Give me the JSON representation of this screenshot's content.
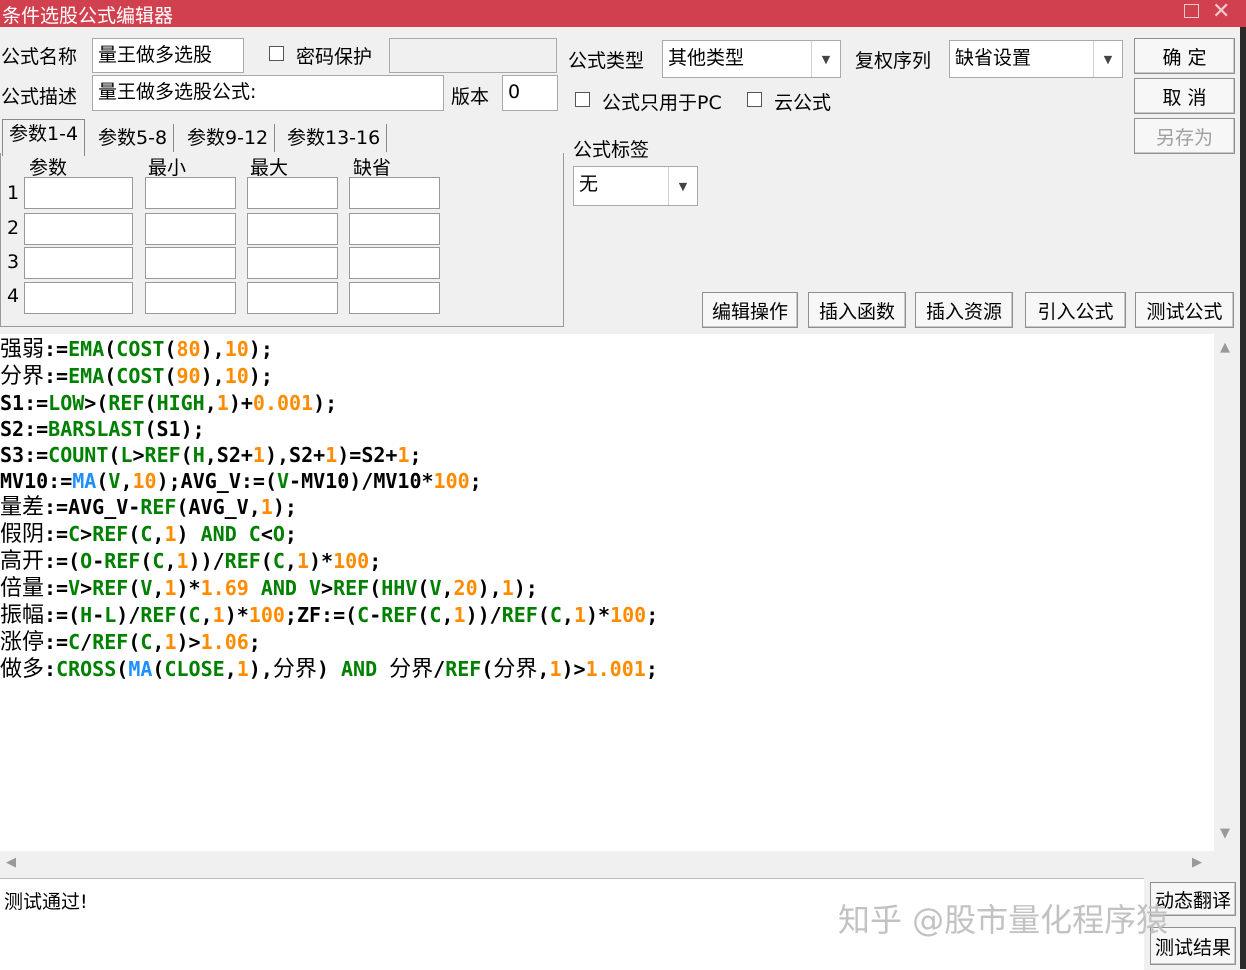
{
  "window": {
    "title": "条件选股公式编辑器"
  },
  "name_label": "公式名称",
  "name_value": "量王做多选股",
  "password_label": "密码保护",
  "desc_label": "公式描述",
  "desc_value": "量王做多选股公式:",
  "version_label": "版本",
  "version_value": "0",
  "type_label": "公式类型",
  "type_value": "其他类型",
  "fuquan_label": "复权序列",
  "fuquan_value": "缺省设置",
  "pc_only_label": "公式只用于PC",
  "cloud_label": "云公式",
  "tag_label": "公式标签",
  "tag_value": "无",
  "buttons": {
    "ok": "确  定",
    "cancel": "取  消",
    "save_as": "另存为",
    "edit_ops": "编辑操作",
    "insert_func": "插入函数",
    "insert_res": "插入资源",
    "import_formula": "引入公式",
    "test_formula": "测试公式",
    "dynamic_translate": "动态翻译",
    "test_result": "测试结果"
  },
  "tabs": [
    "参数1-4",
    "参数5-8",
    "参数9-12",
    "参数13-16"
  ],
  "param_headers": [
    "参数",
    "最小",
    "最大",
    "缺省"
  ],
  "param_rows": [
    "1",
    "2",
    "3",
    "4"
  ],
  "code_lines": [
    "强弱:=EMA(COST(80),10);",
    "分界:=EMA(COST(90),10);",
    "S1:=LOW>(REF(HIGH,1)+0.001);",
    "S2:=BARSLAST(S1);",
    "S3:=COUNT(L>REF(H,S2+1),S2+1)=S2+1;",
    "MV10:=MA(V,10);AVG_V:=(V-MV10)/MV10*100;",
    "量差:=AVG_V-REF(AVG_V,1);",
    "假阴:=C>REF(C,1) AND C<O;",
    "高开:=(O-REF(C,1))/REF(C,1)*100;",
    "倍量:=V>REF(V,1)*1.69 AND V>REF(HHV(V,20),1);",
    "振幅:=(H-L)/REF(C,1)*100;ZF:=(C-REF(C,1))/REF(C,1)*100;",
    "涨停:=C/REF(C,1)>1.06;",
    "做多:CROSS(MA(CLOSE,1),分界) AND 分界/REF(分界,1)>1.001;"
  ],
  "status_text": "测试通过!",
  "watermark": "知乎 @股市量化程序猿"
}
